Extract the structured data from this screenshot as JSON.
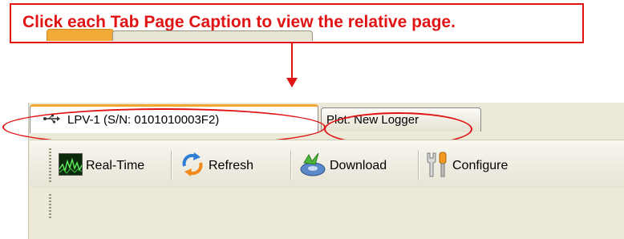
{
  "callout": {
    "text": "Click each Tab Page Caption to view the relative page."
  },
  "tabs": [
    {
      "label": "LPV-1 (S/N: 0101010003F2)",
      "icon": "usb-icon",
      "active": true
    },
    {
      "label": "Plot: New Logger",
      "active": false
    }
  ],
  "toolbar": {
    "realtime": {
      "label": "Real-Time",
      "icon": "waveform-monitor-icon"
    },
    "refresh": {
      "label": "Refresh",
      "icon": "refresh-arrows-icon"
    },
    "download": {
      "label": "Download",
      "icon": "download-disk-icon"
    },
    "configure": {
      "label": "Configure",
      "icon": "tools-icon"
    }
  },
  "colors": {
    "callout_red": "#e01414",
    "active_tab_accent": "#f2a530"
  }
}
